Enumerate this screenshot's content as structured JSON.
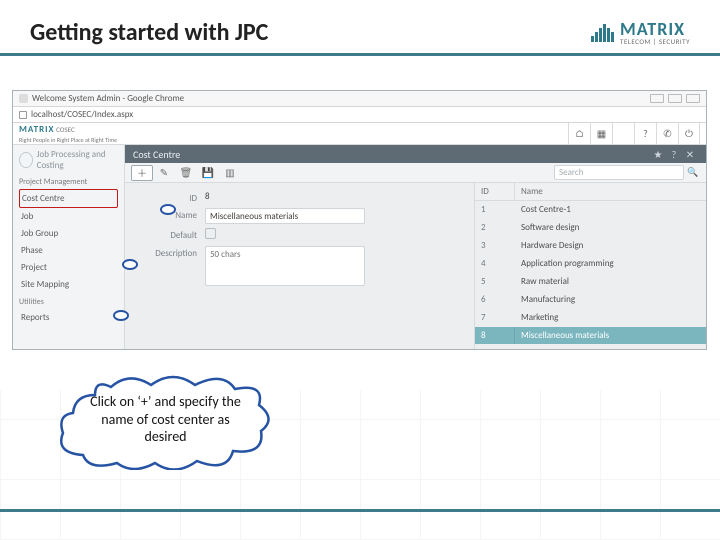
{
  "slide": {
    "title": "Getting started with JPC"
  },
  "brand": {
    "name": "MATRIX",
    "tagline": "TELECOM | SECURITY"
  },
  "chrome": {
    "title": "Welcome System Admin - Google Chrome",
    "url": "localhost/COSEC/Index.aspx"
  },
  "app": {
    "brand": "MATRIX",
    "product": "COSEC",
    "slogan": "Right People in Right Place at Right Time",
    "topicons": [
      "home-icon",
      "grid-icon",
      "blank",
      "help-icon",
      "phone-icon",
      "power-icon"
    ]
  },
  "sidebar": {
    "module": "Job Processing and Costing",
    "sections": [
      {
        "header": "Project Management",
        "items": [
          "Cost Centre",
          "Job",
          "Job Group",
          "Phase",
          "Project",
          "Site Mapping"
        ]
      },
      {
        "header": "Utilities",
        "items": [
          "Reports"
        ]
      }
    ],
    "selected": "Cost Centre"
  },
  "panel": {
    "title": "Cost Centre",
    "toolbar": {
      "buttons": [
        "plus",
        "edit",
        "delete",
        "save",
        "more"
      ],
      "search_placeholder": "Search"
    },
    "form": {
      "id_label": "ID",
      "id_value": "8",
      "name_label": "Name",
      "name_value": "Miscellaneous materials",
      "default_label": "Default",
      "description_label": "Description",
      "description_placeholder": "50 chars"
    },
    "list": {
      "columns": [
        "ID",
        "Name"
      ],
      "rows": [
        {
          "id": "1",
          "name": "Cost Centre-1"
        },
        {
          "id": "2",
          "name": "Software design"
        },
        {
          "id": "3",
          "name": "Hardware Design"
        },
        {
          "id": "4",
          "name": "Application programming"
        },
        {
          "id": "5",
          "name": "Raw material"
        },
        {
          "id": "6",
          "name": "Manufacturing"
        },
        {
          "id": "7",
          "name": "Marketing"
        },
        {
          "id": "8",
          "name": "Miscellaneous materials"
        }
      ],
      "selected_id": "8"
    }
  },
  "callout": {
    "text": "Click on ‘+’ and specify the name of cost center as desired"
  },
  "colors": {
    "accent": "#3c7b8c",
    "selrow": "#7bb6bf",
    "highlight": "#c11b1b",
    "cloud": "#2653a3"
  }
}
